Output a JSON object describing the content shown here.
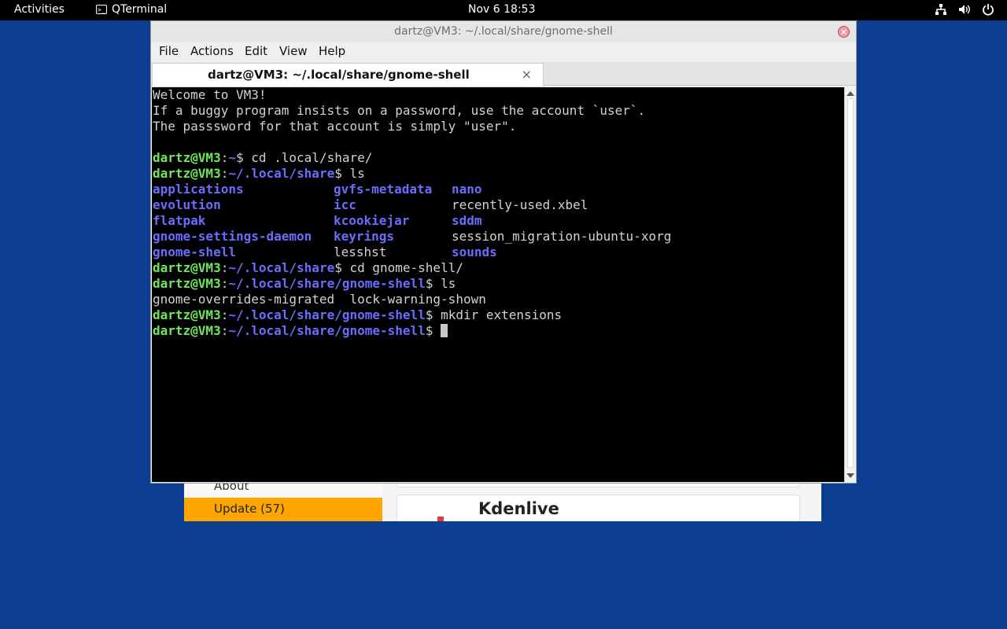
{
  "topbar": {
    "activities": "Activities",
    "app_name": "QTerminal",
    "app_icon_glyph": ">_",
    "clock": "Nov 6  18:53",
    "tray_icons": [
      "network-icon",
      "volume-icon",
      "power-icon"
    ]
  },
  "background_window": {
    "sidebar_about": "About",
    "sidebar_update": "Update (57)",
    "app_title": "Kdenlive",
    "accent_color": "#ffa500"
  },
  "window": {
    "title": "dartz@VM3: ~/.local/share/gnome-shell",
    "menu": [
      "File",
      "Actions",
      "Edit",
      "View",
      "Help"
    ],
    "tab_label": "dartz@VM3: ~/.local/share/gnome-shell"
  },
  "terminal": {
    "motd": [
      "Welcome to VM3!",
      "If a buggy program insists on a password, use the account `user`.",
      "The passsword for that account is simply \"user\"."
    ],
    "user": "dartz@VM3",
    "prompts": [
      {
        "path": "~",
        "cmd": "cd .local/share/"
      },
      {
        "path": "~/.local/share",
        "cmd": "ls"
      },
      {
        "path": "~/.local/share",
        "cmd": "cd gnome-shell/"
      },
      {
        "path": "~/.local/share/gnome-shell",
        "cmd": "ls"
      },
      {
        "path": "~/.local/share/gnome-shell",
        "cmd": "mkdir extensions"
      },
      {
        "path": "~/.local/share/gnome-shell",
        "cmd": ""
      }
    ],
    "ls_share": [
      [
        "applications",
        "gvfs-metadata",
        "nano"
      ],
      [
        "evolution",
        "icc",
        "recently-used.xbel"
      ],
      [
        "flatpak",
        "kcookiejar",
        "sddm"
      ],
      [
        "gnome-settings-daemon",
        "keyrings",
        "session_migration-ubuntu-xorg"
      ],
      [
        "gnome-shell",
        "lesshst",
        "sounds"
      ]
    ],
    "ls_gnome_shell": "gnome-overrides-migrated  lock-warning-shown",
    "colors": {
      "user": "#6fe85a",
      "path": "#6b6cff",
      "dir": "#6b6cff",
      "text": "#d2d2d2"
    }
  }
}
